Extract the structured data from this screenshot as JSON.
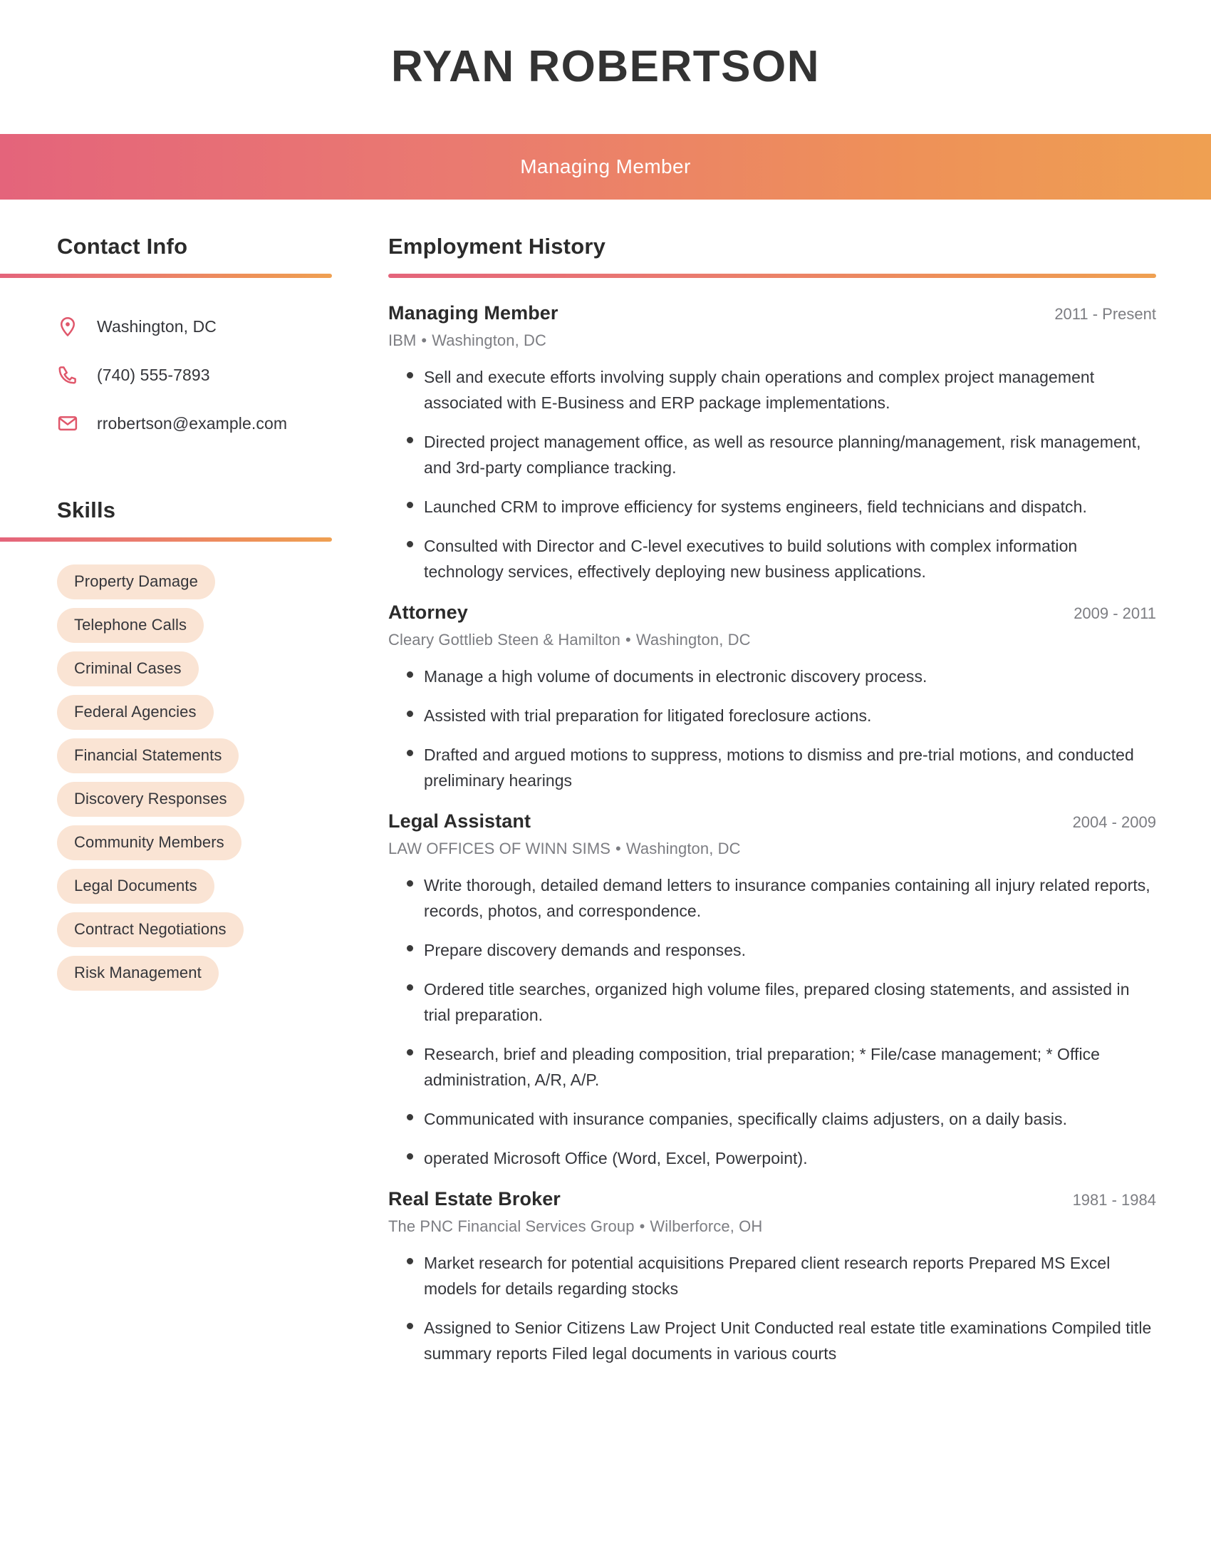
{
  "header": {
    "name": "RYAN ROBERTSON",
    "title": "Managing Member"
  },
  "theme": {
    "gradient_start": "#e4647b",
    "gradient_end": "#efa052",
    "icon_color": "#e0576b",
    "pill_bg": "#fae4d4",
    "text_dark": "#34353a",
    "text_muted": "#7c7d82"
  },
  "sidebar": {
    "contact": {
      "heading": "Contact Info",
      "items": [
        {
          "icon": "location-pin-icon",
          "value": "Washington, DC"
        },
        {
          "icon": "phone-icon",
          "value": "(740) 555-7893"
        },
        {
          "icon": "envelope-icon",
          "value": "rrobertson@example.com"
        }
      ]
    },
    "skills": {
      "heading": "Skills",
      "items": [
        "Property Damage",
        "Telephone Calls",
        "Criminal Cases",
        "Federal Agencies",
        "Financial Statements",
        "Discovery Responses",
        "Community Members",
        "Legal Documents",
        "Contract Negotiations",
        "Risk Management"
      ]
    }
  },
  "main": {
    "employment": {
      "heading": "Employment History",
      "jobs": [
        {
          "role": "Managing Member",
          "dates": "2011 - Present",
          "company": "IBM",
          "location": "Washington, DC",
          "bullets": [
            "Sell and execute efforts involving supply chain operations and complex project management associated with E-Business and ERP package implementations.",
            "Directed project management office, as well as resource planning/management, risk management, and 3rd-party compliance tracking.",
            "Launched CRM to improve efficiency for systems engineers, field technicians and dispatch.",
            "Consulted with Director and C-level executives to build solutions with complex information technology services, effectively deploying new business applications."
          ]
        },
        {
          "role": "Attorney",
          "dates": "2009 - 2011",
          "company": "Cleary Gottlieb Steen & Hamilton",
          "location": "Washington, DC",
          "bullets": [
            "Manage a high volume of documents in electronic discovery process.",
            "Assisted with trial preparation for litigated foreclosure actions.",
            "Drafted and argued motions to suppress, motions to dismiss and pre-trial motions, and conducted preliminary hearings"
          ]
        },
        {
          "role": "Legal Assistant",
          "dates": "2004 - 2009",
          "company": "LAW OFFICES OF WINN SIMS",
          "location": "Washington, DC",
          "bullets": [
            "Write thorough, detailed demand letters to insurance companies containing all injury related reports, records, photos, and correspondence.",
            "Prepare discovery demands and responses.",
            "Ordered title searches, organized high volume files, prepared closing statements, and assisted in trial preparation.",
            "Research, brief and pleading composition, trial preparation; * File/case management; * Office administration, A/R, A/P.",
            "Communicated with insurance companies, specifically claims adjusters, on a daily basis.",
            "operated Microsoft Office (Word, Excel, Powerpoint)."
          ]
        },
        {
          "role": "Real Estate Broker",
          "dates": "1981 - 1984",
          "company": "The PNC Financial Services Group",
          "location": "Wilberforce, OH",
          "bullets": [
            "Market research for potential acquisitions Prepared client research reports Prepared MS Excel models for details regarding stocks",
            "Assigned to Senior Citizens Law Project Unit Conducted real estate title examinations Compiled title summary reports Filed legal documents in various courts"
          ]
        }
      ]
    }
  }
}
